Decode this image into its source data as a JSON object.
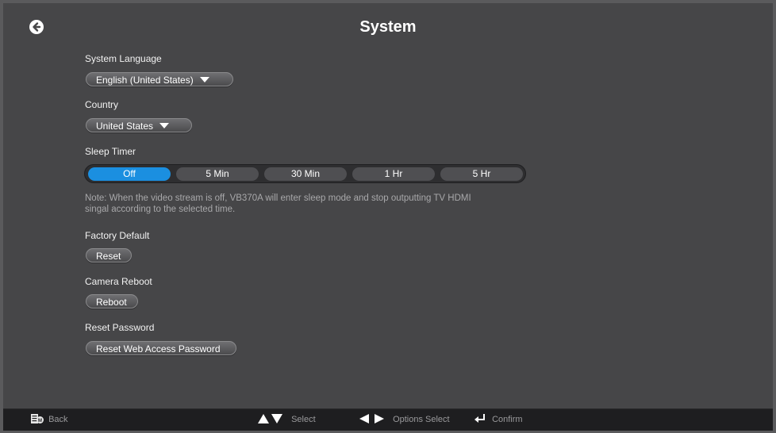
{
  "header": {
    "title": "System",
    "back_icon": "arrow-left-circle-icon"
  },
  "system_language": {
    "label": "System Language",
    "selected": "English (United States)"
  },
  "country": {
    "label": "Country",
    "selected": "United States"
  },
  "sleep_timer": {
    "label": "Sleep Timer",
    "options": [
      "Off",
      "5 Min",
      "30 Min",
      "1 Hr",
      "5 Hr"
    ],
    "selected": "Off",
    "note_line1": "Note: When the video stream is off, VB370A will enter sleep mode and stop outputting TV HDMI",
    "note_line2": "singal according to the selected time."
  },
  "factory_default": {
    "label": "Factory Default",
    "button": "Reset"
  },
  "camera_reboot": {
    "label": "Camera Reboot",
    "button": "Reboot"
  },
  "reset_password": {
    "label": "Reset Password",
    "button": "Reset Web Access Password"
  },
  "footer": {
    "back": "Back",
    "select": "Select",
    "options_select": "Options Select",
    "confirm": "Confirm"
  },
  "colors": {
    "background": "#464648",
    "accent": "#1b8fe0",
    "footer": "#1e1e20"
  }
}
